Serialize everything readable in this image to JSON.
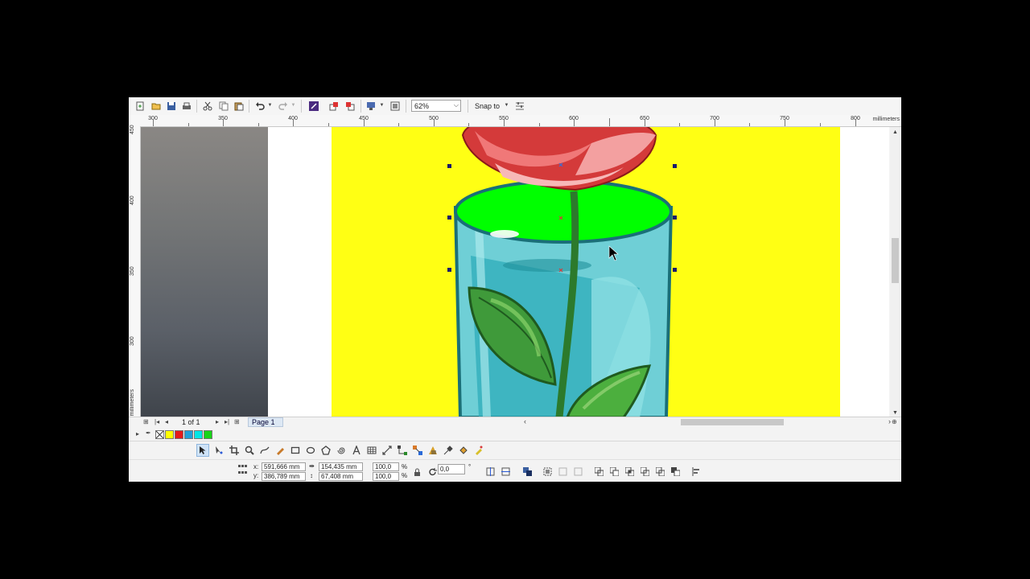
{
  "toolbar": {
    "icons": [
      "new-icon",
      "open-icon",
      "save-icon",
      "print-icon",
      "cut-icon",
      "copy-icon",
      "paste-icon",
      "undo-icon",
      "redo-icon",
      "search-content-icon",
      "import-icon",
      "export-icon",
      "publish-pdf-icon",
      "application-launcher-icon",
      "options-icon"
    ],
    "zoom_value": "62%",
    "snap_label": "Snap to"
  },
  "ruler_top": {
    "labels": [
      "300",
      "350",
      "400",
      "450",
      "500",
      "550",
      "600",
      "650",
      "700",
      "750",
      "800"
    ],
    "unit": "millimeters"
  },
  "ruler_left": {
    "labels": [
      "400",
      "350",
      "300"
    ],
    "top_label": "450",
    "unit": "millimeters"
  },
  "page_nav": {
    "page_count": "1 of 1",
    "page_tab": "Page 1"
  },
  "palette": {
    "swatches": [
      "#ffff00",
      "#e41a1a",
      "#1fa0d8",
      "#00e5e5",
      "#18d418"
    ]
  },
  "toolbox": {
    "tools": [
      "pick-tool",
      "shape-tool",
      "crop-tool",
      "zoom-tool",
      "freehand-tool",
      "artistic-media-tool",
      "rectangle-tool",
      "ellipse-tool",
      "polygon-tool",
      "spiral-tool",
      "text-tool",
      "table-tool",
      "parallel-dimension-tool",
      "connector-tool",
      "blend-tool",
      "transparency-tool",
      "eyedropper-tool",
      "interactive-fill-tool",
      "smart-fill-tool"
    ]
  },
  "property_bar": {
    "x_label": "x:",
    "y_label": "y:",
    "x_value": "591,666 mm",
    "y_value": "386,789 mm",
    "width_value": "154,435 mm",
    "height_value": "67,408 mm",
    "scale_x": "100,0",
    "scale_y": "100,0",
    "percent": "%",
    "rotation": "0,0",
    "degree": "°"
  }
}
